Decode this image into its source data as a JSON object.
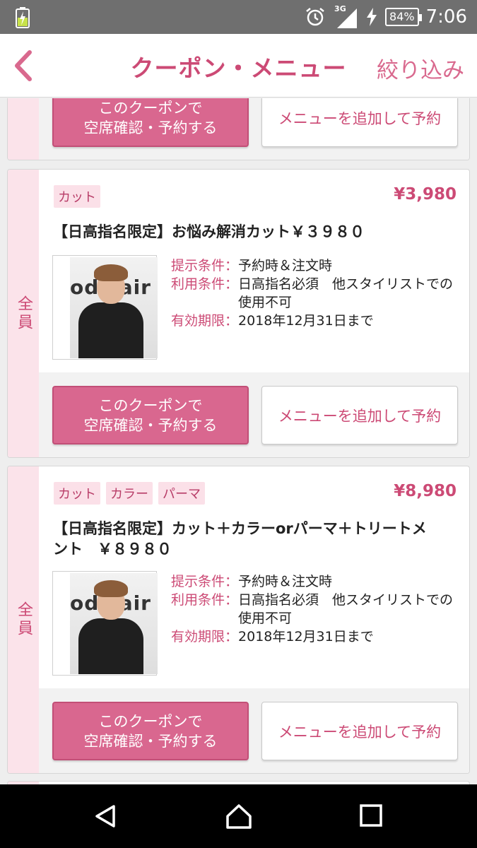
{
  "status_bar": {
    "network": "3G",
    "battery": "84%",
    "time": "7:06"
  },
  "header": {
    "title": "クーポン・メニュー",
    "filter_label": "絞り込み"
  },
  "side_label": "全員",
  "buttons": {
    "book_coupon": "このクーポンで\n空席確認・予約する",
    "add_menu": "メニューを追加して予約"
  },
  "photo_sign_text": "ods air",
  "coupons": [
    {
      "tags": [
        "カット"
      ],
      "price": "¥3,980",
      "name": "【日高指名限定】お悩み解消カット￥３９８０",
      "conditions": [
        {
          "label": "提示条件：",
          "value": "予約時＆注文時"
        },
        {
          "label": "利用条件：",
          "value": "日高指名必須　他スタイリストでの使用不可"
        },
        {
          "label": "有効期限：",
          "value": "2018年12月31日まで"
        }
      ]
    },
    {
      "tags": [
        "カット",
        "カラー",
        "パーマ"
      ],
      "price": "¥8,980",
      "name": "【日高指名限定】カット＋カラーorパーマ＋トリートメント　￥８９８０",
      "conditions": [
        {
          "label": "提示条件：",
          "value": "予約時＆注文時"
        },
        {
          "label": "利用条件：",
          "value": "日高指名必須　他スタイリストでの使用不可"
        },
        {
          "label": "有効期限：",
          "value": "2018年12月31日まで"
        }
      ]
    }
  ],
  "colors": {
    "accent": "#cc4a75",
    "primary_button": "#d9678f",
    "side_band": "#fbe3ea",
    "status_bar": "#6f6f6f"
  }
}
